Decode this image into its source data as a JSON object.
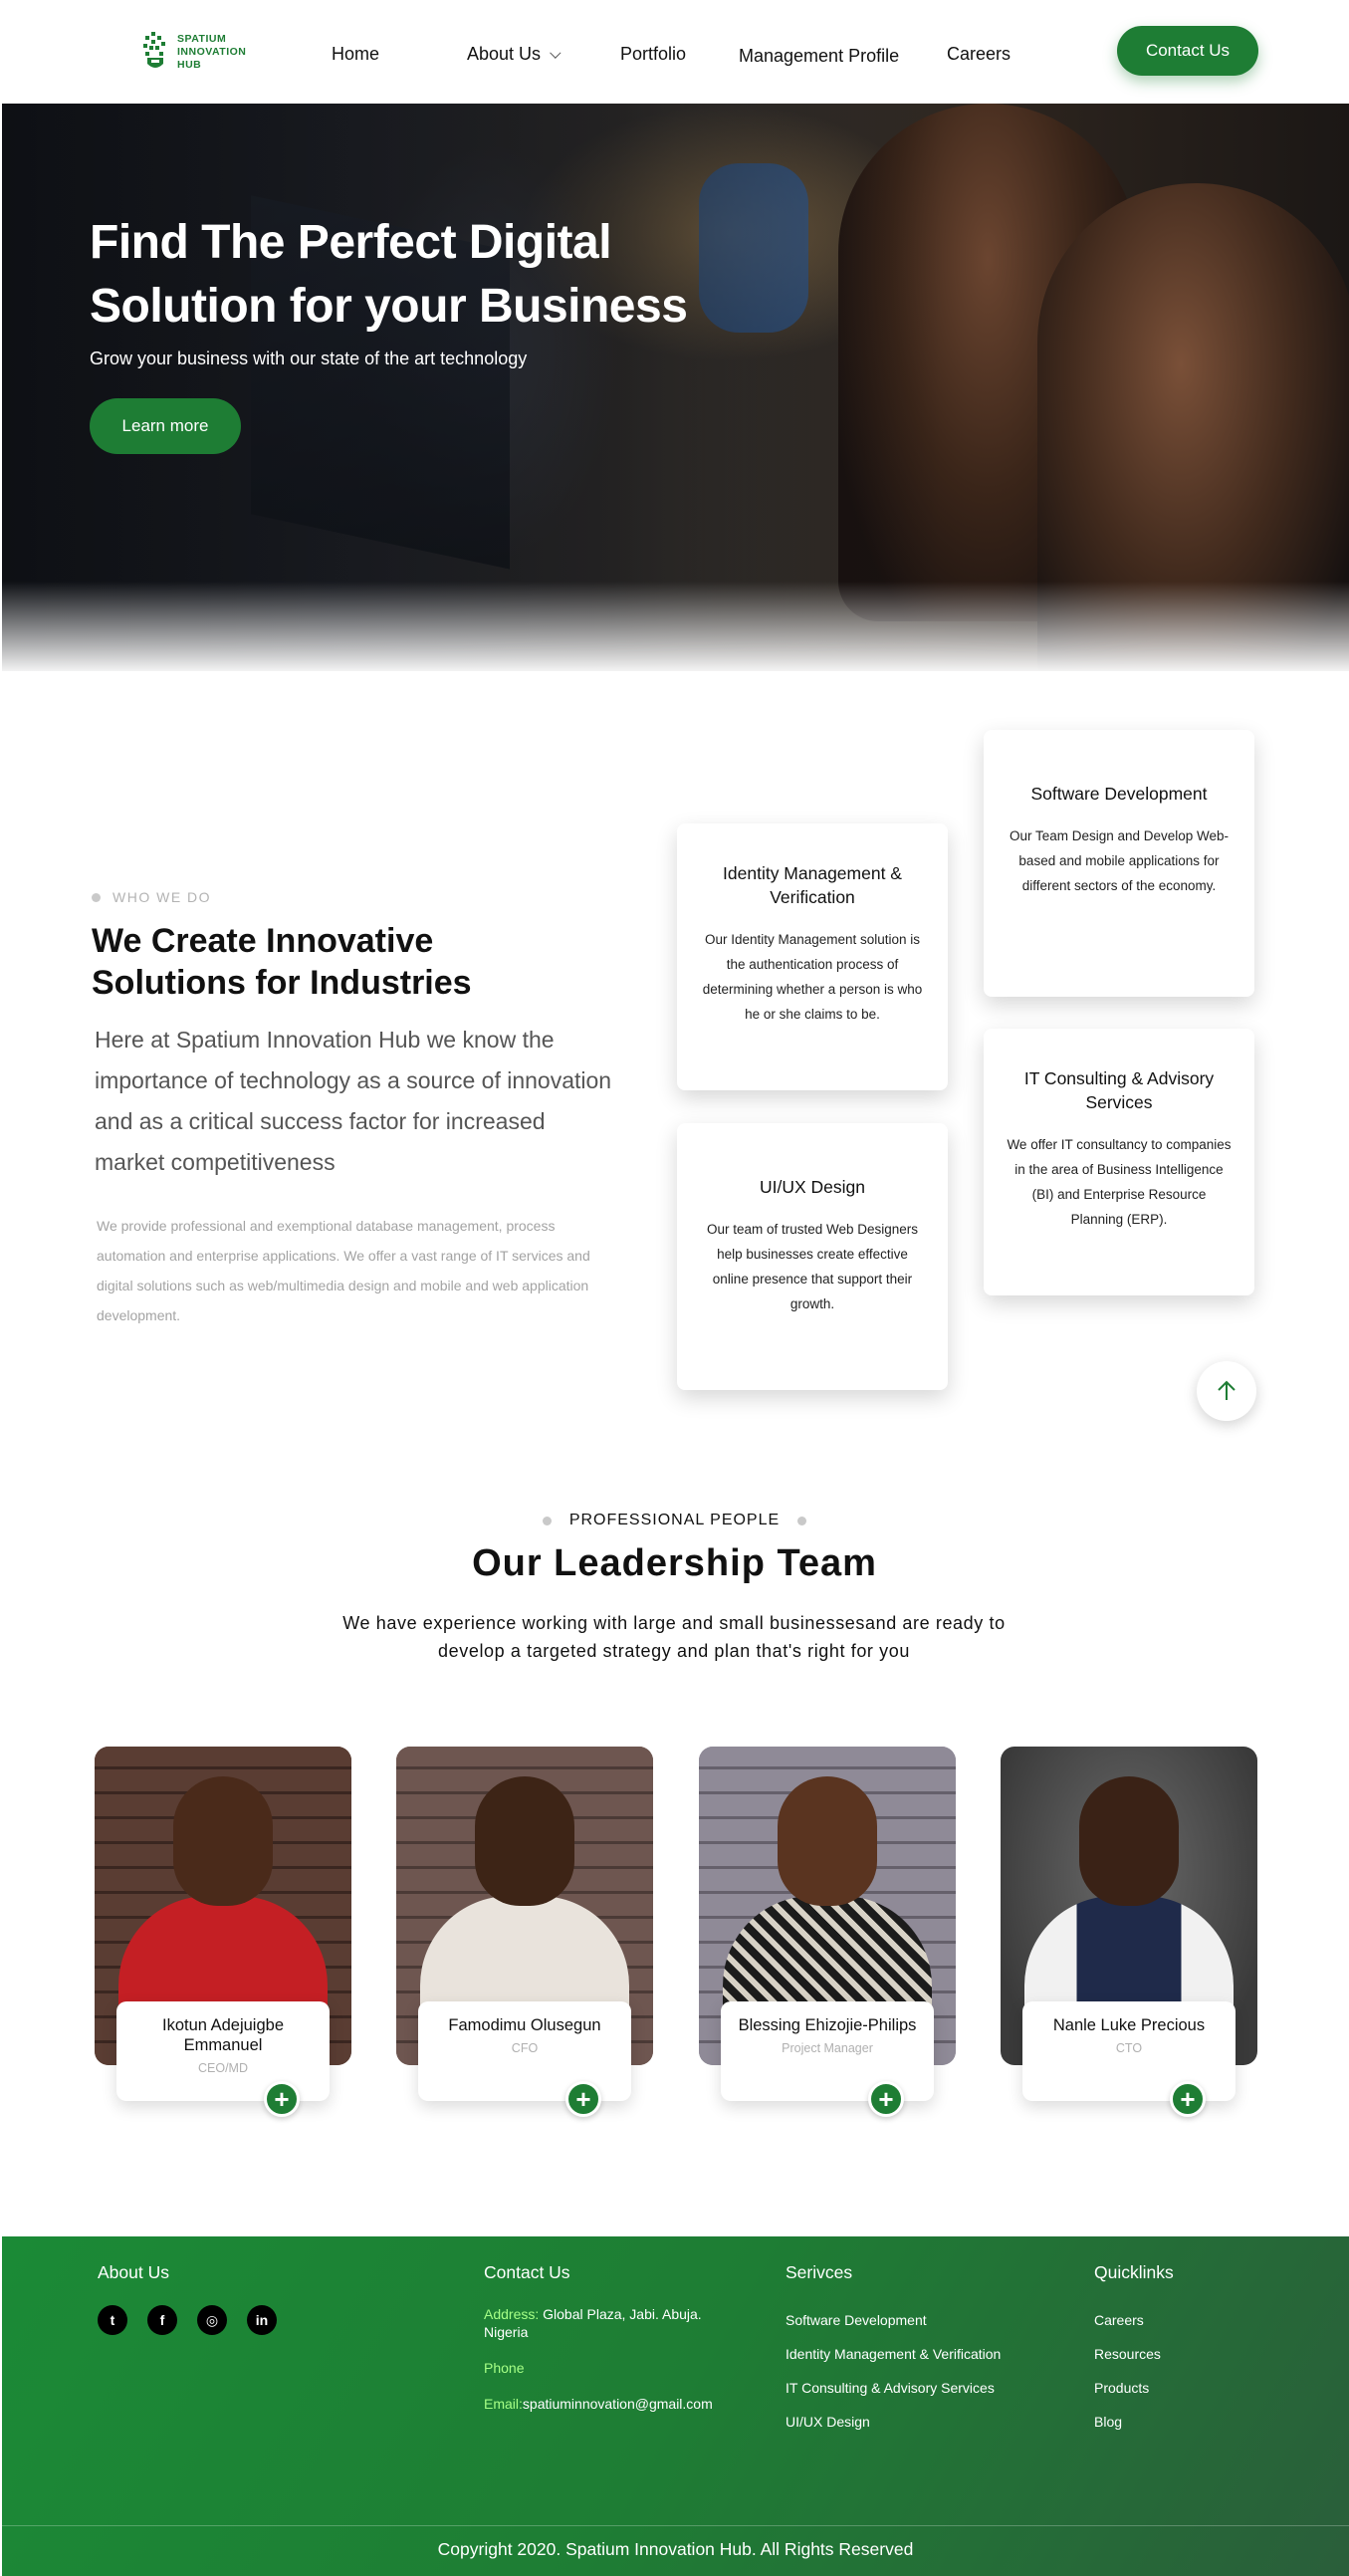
{
  "nav": {
    "logo_lines": [
      "SPATIUM",
      "INNOVATION",
      "HUB"
    ],
    "links": [
      {
        "label": "Home"
      },
      {
        "label": "About Us"
      },
      {
        "label": "Portfolio"
      },
      {
        "label": "Management Profile"
      },
      {
        "label": "Careers"
      }
    ],
    "contact_label": "Contact Us"
  },
  "hero": {
    "title": "Find The Perfect Digital Solution for your Business",
    "subtitle": "Grow your business with our state of the art technology",
    "cta": "Learn more"
  },
  "who": {
    "eyebrow": "WHO WE DO",
    "title": "We Create Innovative Solutions for Industries",
    "lead": "Here at Spatium Innovation Hub we know the importance of technology as a source of innovation and as a critical success factor for increased market competitiveness",
    "body": "We provide professional and exemptional database management, process automation and enterprise applications. We offer a vast range of IT services and digital solutions such as web/multimedia design and mobile and web application development.",
    "services": [
      {
        "title": "Identity Management & Verification",
        "text": "Our Identity Management solution is the authentication process of determining whether a person is who he or she claims to be."
      },
      {
        "title": "Software Development",
        "text": "Our Team Design and Develop Web-based and mobile applications for different sectors of the economy."
      },
      {
        "title": "UI/UX Design",
        "text": "Our team of trusted Web Designers help businesses create effective online presence that support their growth."
      },
      {
        "title": "IT Consulting & Advisory Services",
        "text": "We offer IT consultancy to companies in the area of Business Intelligence (BI) and Enterprise Resource Planning (ERP)."
      }
    ]
  },
  "leadership": {
    "eyebrow": "PROFESSIONAL PEOPLE",
    "title": "Our Leadership Team",
    "subtitle": "We have experience working with large and small businessesand are ready to develop a targeted strategy and plan that's right for you",
    "members": [
      {
        "name": "Ikotun Adejuigbe Emmanuel",
        "role": "CEO/MD"
      },
      {
        "name": "Famodimu Olusegun",
        "role": "CFO"
      },
      {
        "name": "Blessing Ehizojie-Philips",
        "role": "Project Manager"
      },
      {
        "name": "Nanle Luke Precious",
        "role": "CTO"
      }
    ],
    "plus_glyph": "+"
  },
  "footer": {
    "about_title": "About Us",
    "social": [
      {
        "icon": "twitter-icon",
        "glyph": "t"
      },
      {
        "icon": "facebook-icon",
        "glyph": "f"
      },
      {
        "icon": "instagram-icon",
        "glyph": "◎"
      },
      {
        "icon": "linkedin-icon",
        "glyph": "in"
      }
    ],
    "contact_title": "Contact Us",
    "address_label": "Address:",
    "address_value": " Global Plaza, Jabi. Abuja. Nigeria",
    "phone_label": "Phone",
    "email_label": "Email:",
    "email_value": "spatiuminnovation@gmail.com",
    "services_title": "Serivces",
    "services": [
      "Software Development",
      "Identity Management & Verification",
      "IT Consulting & Advisory Services",
      "UI/UX Design"
    ],
    "quick_title": "Quicklinks",
    "quicklinks": [
      "Careers",
      "Resources",
      "Products",
      "Blog"
    ],
    "copyright": "Copyright  2020. Spatium Innovation Hub. All Rights Reserved"
  },
  "colors": {
    "brand_green": "#1e7d34",
    "footer_label_green": "#a6ff86"
  }
}
